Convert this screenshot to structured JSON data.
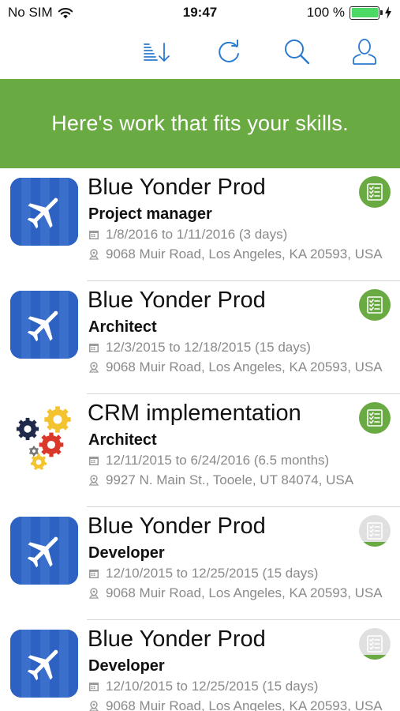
{
  "status_bar": {
    "carrier": "No SIM",
    "time": "19:47",
    "battery": "100 %",
    "battery_level": 1.0
  },
  "toolbar": {
    "icons": [
      "sort-icon",
      "refresh-icon",
      "search-icon",
      "profile-icon"
    ],
    "accent_color": "#2a7bd0"
  },
  "banner": {
    "text": "Here's work that fits your skills.",
    "color": "#6aaa42"
  },
  "jobs": [
    {
      "title": "Blue Yonder Prod",
      "role": "Project manager",
      "dates": "1/8/2016 to 1/11/2016 (3 days)",
      "address": "9068 Muir Road, Los Angeles, KA 20593, USA",
      "image": "airplane",
      "status": "active"
    },
    {
      "title": "Blue Yonder Prod",
      "role": "Architect",
      "dates": "12/3/2015 to 12/18/2015 (15 days)",
      "address": "9068 Muir Road, Los Angeles, KA 20593, USA",
      "image": "airplane",
      "status": "active"
    },
    {
      "title": "CRM implementation",
      "role": "Architect",
      "dates": "12/11/2015 to 6/24/2016 (6.5 months)",
      "address": "9927 N. Main St., Tooele, UT 84074, USA",
      "image": "gears",
      "status": "active"
    },
    {
      "title": "Blue Yonder Prod",
      "role": "Developer",
      "dates": "12/10/2015 to 12/25/2015 (15 days)",
      "address": "9068 Muir Road, Los Angeles, KA 20593, USA",
      "image": "airplane",
      "status": "pending"
    },
    {
      "title": "Blue Yonder Prod",
      "role": "Developer",
      "dates": "12/10/2015 to 12/25/2015 (15 days)",
      "address": "9068 Muir Road, Los Angeles, KA 20593, USA",
      "image": "airplane",
      "status": "pending"
    }
  ]
}
